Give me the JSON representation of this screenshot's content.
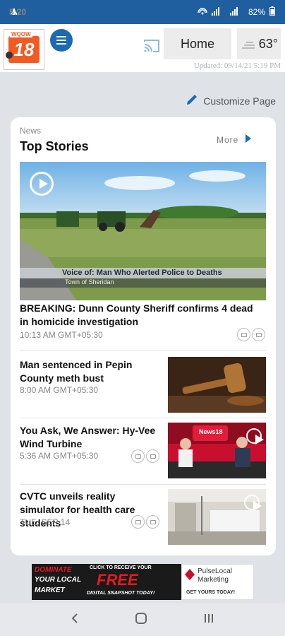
{
  "status_bar": {
    "time": "5:20",
    "battery": "82%",
    "network_labels": [
      "Vo LTE",
      "Vo LTE"
    ]
  },
  "header": {
    "logo": {
      "channel_number": "18",
      "call_sign": "WQOW"
    },
    "home_label": "Home",
    "temperature": "63°",
    "updated": "Updated: 09/14/21 5:19 PM"
  },
  "customize_label": "Customize Page",
  "section": {
    "category": "News",
    "title": "Top Stories",
    "more_label": "More"
  },
  "hero": {
    "lower_third_line1": "Voice of: Man Who Alerted Police to Deaths",
    "lower_third_line2": "Town of Sheridan"
  },
  "stories": [
    {
      "headline": "BREAKING: Dunn County Sheriff confirms 4 dead in homicide investigation",
      "time": "10:13 AM GMT+05:30"
    },
    {
      "headline": "Man sentenced in Pepin County meth bust",
      "time": "8:00 AM GMT+05:30"
    },
    {
      "headline": "You Ask, We Answer: Hy-Vee Wind Turbine",
      "time": "5:36 AM GMT+05:30",
      "thumb_text": "News18"
    },
    {
      "headline": "CVTC unveils reality simulator for health care students",
      "time": "TUE, SEP 14"
    }
  ],
  "ad": {
    "left_line1": "DOMINATE",
    "left_line2": "YOUR LOCAL",
    "left_line3": "MARKET",
    "cta_top": "CLICK TO RECEIVE YOUR",
    "cta_main": "FREE",
    "cta_bottom": "DIGITAL SNAPSHOT TODAY!",
    "brand_line1": "PulseLocal",
    "brand_line2": "Marketing",
    "brand_cta": "GET YOURS TODAY!"
  },
  "colors": {
    "status_bar": "#1f5fa0",
    "accent": "#1e6ab0",
    "logo_orange": "#f15a22",
    "page_bg": "#dfe3e8"
  }
}
